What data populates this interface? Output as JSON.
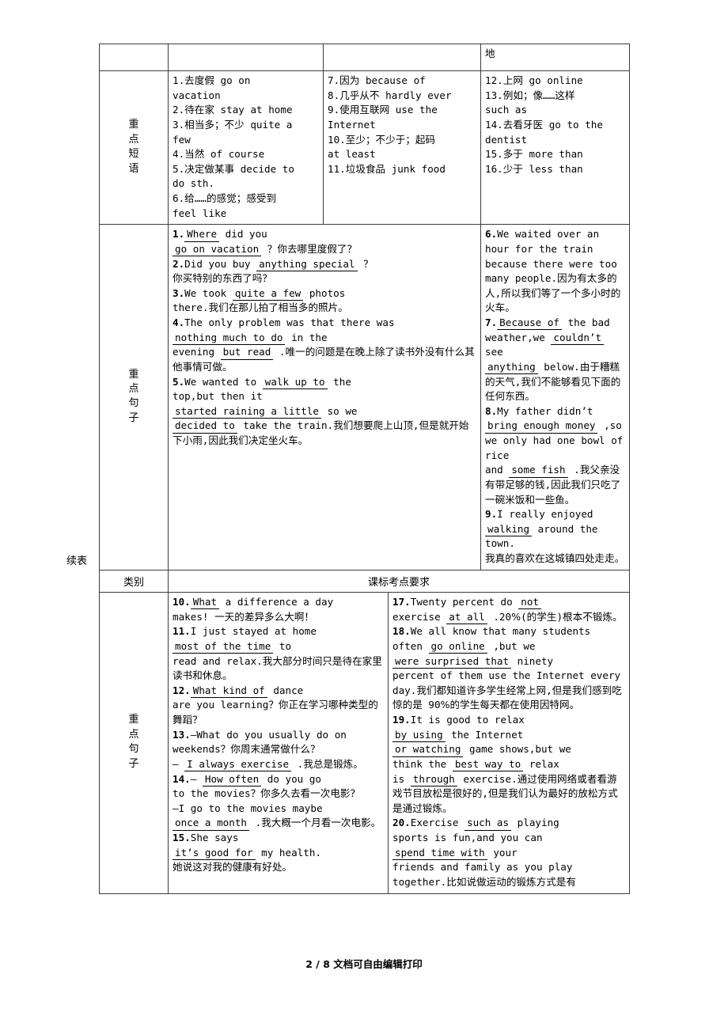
{
  "page": {
    "footer": "2 / 8 文档可自由编辑打印",
    "continued_caption": "续表"
  },
  "table1": {
    "top_row": {
      "col1": "",
      "col2": "",
      "col3": "",
      "col4": "地"
    },
    "rows": [
      {
        "label": "重点短语",
        "col_a": [
          "1.去度假 go on",
          "vacation",
          "2.待在家 stay at home",
          "3.相当多；不少 quite a",
          "few",
          "4.当然 of course",
          "5.决定做某事 decide to",
          "do sth.",
          "6.给……的感觉；感受到",
          "feel like"
        ],
        "col_b": [
          "7.因为 because of",
          "8.几乎从不 hardly ever",
          "9.使用互联网 use the",
          "Internet",
          "10.至少；不少于；起码",
          "at least",
          "11.垃圾食品 junk food"
        ],
        "col_c": [
          "12.上网 go online",
          "13.例如；像……这样",
          "such as",
          "14.去看牙医 go to the",
          "dentist",
          "15.多于 more than",
          "16.少于 less than"
        ]
      },
      {
        "label": "重点句子",
        "col_left_sentences": [
          {
            "num": "1.",
            "parts": [
              {
                "t": "fill",
                "v": "Where"
              },
              {
                "t": "txt",
                "v": " did you"
              },
              {
                "t": "br"
              },
              {
                "t": "fill",
                "v": "go on vacation"
              },
              {
                "t": "txt",
                "v": " ？你去哪里度假了？"
              }
            ]
          },
          {
            "num": "2.",
            "parts": [
              {
                "t": "txt",
                "v": "Did you buy "
              },
              {
                "t": "fill",
                "v": "anything special"
              },
              {
                "t": "txt",
                "v": " ？"
              },
              {
                "t": "br"
              },
              {
                "t": "txt",
                "v": "你买特别的东西了吗？"
              }
            ]
          },
          {
            "num": "3.",
            "parts": [
              {
                "t": "txt",
                "v": "We took "
              },
              {
                "t": "fill",
                "v": "quite a few"
              },
              {
                "t": "txt",
                "v": " photos"
              },
              {
                "t": "br"
              },
              {
                "t": "txt",
                "v": "there.我们在那儿拍了相当多的照片。"
              }
            ]
          },
          {
            "num": "4.",
            "parts": [
              {
                "t": "txt",
                "v": "The only problem was that there was"
              },
              {
                "t": "br"
              },
              {
                "t": "fill",
                "v": "nothing much to do"
              },
              {
                "t": "txt",
                "v": " in the"
              },
              {
                "t": "br"
              },
              {
                "t": "txt",
                "v": "evening "
              },
              {
                "t": "fill",
                "v": "but read"
              },
              {
                "t": "txt",
                "v": " .唯一的问题是在晚上除了读书外没有什么其他事情可做。"
              }
            ]
          },
          {
            "num": "5.",
            "parts": [
              {
                "t": "txt",
                "v": "We wanted to "
              },
              {
                "t": "fill",
                "v": "walk up to"
              },
              {
                "t": "txt",
                "v": " the"
              },
              {
                "t": "br"
              },
              {
                "t": "txt",
                "v": "top,but then it"
              },
              {
                "t": "br"
              },
              {
                "t": "fill",
                "v": "started raining a little"
              },
              {
                "t": "txt",
                "v": " so we"
              },
              {
                "t": "br"
              },
              {
                "t": "fill",
                "v": "decided to"
              },
              {
                "t": "txt",
                "v": " take the train.我们想要爬上山顶,但是就开始下小雨,因此我们决定坐火车。"
              }
            ]
          }
        ],
        "col_right_sentences": [
          {
            "num": "6.",
            "parts": [
              {
                "t": "txt",
                "v": "We waited over an hour for the train because there were too many people.因为有太多的人,所以我们等了一个多小时的火车。"
              }
            ]
          },
          {
            "num": "7.",
            "parts": [
              {
                "t": "fill",
                "v": "Because of"
              },
              {
                "t": "txt",
                "v": " the bad"
              },
              {
                "t": "br"
              },
              {
                "t": "txt",
                "v": "weather,we "
              },
              {
                "t": "fill",
                "v": "couldn’t"
              },
              {
                "t": "txt",
                "v": " see"
              },
              {
                "t": "br"
              },
              {
                "t": "fill",
                "v": "anything"
              },
              {
                "t": "txt",
                "v": " below.由于糟糕的天气,我们不能够看见下面的任何东西。"
              }
            ]
          },
          {
            "num": "8.",
            "parts": [
              {
                "t": "txt",
                "v": "My father didn’t"
              },
              {
                "t": "br"
              },
              {
                "t": "fill",
                "v": "bring enough money"
              },
              {
                "t": "txt",
                "v": " ,so"
              },
              {
                "t": "br"
              },
              {
                "t": "txt",
                "v": "we only had one bowl of rice"
              },
              {
                "t": "br"
              },
              {
                "t": "txt",
                "v": "and "
              },
              {
                "t": "fill",
                "v": "some fish"
              },
              {
                "t": "txt",
                "v": " .我父亲没有带足够的钱,因此我们只吃了一碗米饭和一些鱼。"
              }
            ]
          },
          {
            "num": "9.",
            "parts": [
              {
                "t": "txt",
                "v": "I really enjoyed"
              },
              {
                "t": "br"
              },
              {
                "t": "fill",
                "v": "walking"
              },
              {
                "t": "txt",
                "v": " around the town."
              },
              {
                "t": "br"
              },
              {
                "t": "txt",
                "v": "我真的喜欢在这城镇四处走走。"
              }
            ]
          }
        ]
      }
    ]
  },
  "table2": {
    "header": {
      "col_label": "类别",
      "col_content": "课标考点要求"
    },
    "row": {
      "label": "重点句子",
      "col_left_sentences": [
        {
          "num": "10.",
          "parts": [
            {
              "t": "fill",
              "v": "What"
            },
            {
              "t": "txt",
              "v": " a difference a day"
            },
            {
              "t": "br"
            },
            {
              "t": "txt",
              "v": "makes! 一天的差异多么大啊！"
            }
          ]
        },
        {
          "num": "11.",
          "parts": [
            {
              "t": "txt",
              "v": "I just stayed at home"
            },
            {
              "t": "br"
            },
            {
              "t": "fill",
              "v": "most of the time"
            },
            {
              "t": "txt",
              "v": " to"
            },
            {
              "t": "br"
            },
            {
              "t": "txt",
              "v": "read and relax.我大部分时间只是待在家里读书和休息。"
            }
          ]
        },
        {
          "num": "12.",
          "parts": [
            {
              "t": "fill",
              "v": "What kind of"
            },
            {
              "t": "txt",
              "v": " dance"
            },
            {
              "t": "br"
            },
            {
              "t": "txt",
              "v": "are you learning？你正在学习哪种类型的舞蹈？"
            }
          ]
        },
        {
          "num": "13.",
          "parts": [
            {
              "t": "txt",
              "v": "—What do you usually do on"
            },
            {
              "t": "br"
            },
            {
              "t": "txt",
              "v": "weekends？你周末通常做什么？"
            },
            {
              "t": "br"
            },
            {
              "t": "txt",
              "v": "— "
            },
            {
              "t": "fill",
              "v": "I always exercise"
            },
            {
              "t": "txt",
              "v": " .我总是锻炼。"
            }
          ]
        },
        {
          "num": "14.",
          "parts": [
            {
              "t": "txt",
              "v": "— "
            },
            {
              "t": "fill",
              "v": "How often"
            },
            {
              "t": "txt",
              "v": " do you go"
            },
            {
              "t": "br"
            },
            {
              "t": "txt",
              "v": "to the movies？你多久去看一次电影？"
            },
            {
              "t": "br"
            },
            {
              "t": "txt",
              "v": "—I go to the movies maybe"
            },
            {
              "t": "br"
            },
            {
              "t": "fill",
              "v": "once a month"
            },
            {
              "t": "txt",
              "v": " .我大概一个月看一次电影。"
            }
          ]
        },
        {
          "num": "15.",
          "parts": [
            {
              "t": "txt",
              "v": "She says"
            },
            {
              "t": "br"
            },
            {
              "t": "fill",
              "v": "it’s good for"
            },
            {
              "t": "txt",
              "v": " my health."
            },
            {
              "t": "br"
            },
            {
              "t": "txt",
              "v": "她说这对我的健康有好处。"
            }
          ]
        }
      ],
      "col_right_sentences": [
        {
          "num": "17.",
          "parts": [
            {
              "t": "txt",
              "v": "Twenty percent do "
            },
            {
              "t": "fill",
              "v": "not"
            },
            {
              "t": "br"
            },
            {
              "t": "txt",
              "v": "exercise "
            },
            {
              "t": "fill",
              "v": "at all"
            },
            {
              "t": "txt",
              "v": " .20%(的学生)根本不锻炼。"
            }
          ]
        },
        {
          "num": "18.",
          "parts": [
            {
              "t": "txt",
              "v": "We all know that many students"
            },
            {
              "t": "br"
            },
            {
              "t": "txt",
              "v": "often "
            },
            {
              "t": "fill",
              "v": "go online"
            },
            {
              "t": "txt",
              "v": " ,but we"
            },
            {
              "t": "br"
            },
            {
              "t": "fill",
              "v": "were surprised that"
            },
            {
              "t": "txt",
              "v": " ninety"
            },
            {
              "t": "br"
            },
            {
              "t": "txt",
              "v": "percent of them use the Internet every day.我们都知道许多学生经常上网,但是我们感到吃惊的是 90%的学生每天都在使用因特网。"
            }
          ]
        },
        {
          "num": "19.",
          "parts": [
            {
              "t": "txt",
              "v": "It is good to relax"
            },
            {
              "t": "br"
            },
            {
              "t": "fill",
              "v": "by using"
            },
            {
              "t": "txt",
              "v": " the Internet"
            },
            {
              "t": "br"
            },
            {
              "t": "fill",
              "v": "or watching"
            },
            {
              "t": "txt",
              "v": " game shows,but we"
            },
            {
              "t": "br"
            },
            {
              "t": "txt",
              "v": "think the "
            },
            {
              "t": "fill",
              "v": "best way to"
            },
            {
              "t": "txt",
              "v": " relax"
            },
            {
              "t": "br"
            },
            {
              "t": "txt",
              "v": "is "
            },
            {
              "t": "fill",
              "v": "through"
            },
            {
              "t": "txt",
              "v": " exercise.通过使用网络或者看游戏节目放松是很好的,但是我们认为最好的放松方式是通过锻炼。"
            }
          ]
        },
        {
          "num": "20.",
          "parts": [
            {
              "t": "txt",
              "v": "Exercise "
            },
            {
              "t": "fill",
              "v": "such as"
            },
            {
              "t": "txt",
              "v": " playing"
            },
            {
              "t": "br"
            },
            {
              "t": "txt",
              "v": "sports is fun,and you can"
            },
            {
              "t": "br"
            },
            {
              "t": "fill",
              "v": "spend time with"
            },
            {
              "t": "txt",
              "v": " your"
            },
            {
              "t": "br"
            },
            {
              "t": "txt",
              "v": "friends and family as you play"
            },
            {
              "t": "br"
            },
            {
              "t": "txt",
              "v": "together.比如说做运动的锻炼方式是有"
            }
          ]
        }
      ]
    }
  }
}
